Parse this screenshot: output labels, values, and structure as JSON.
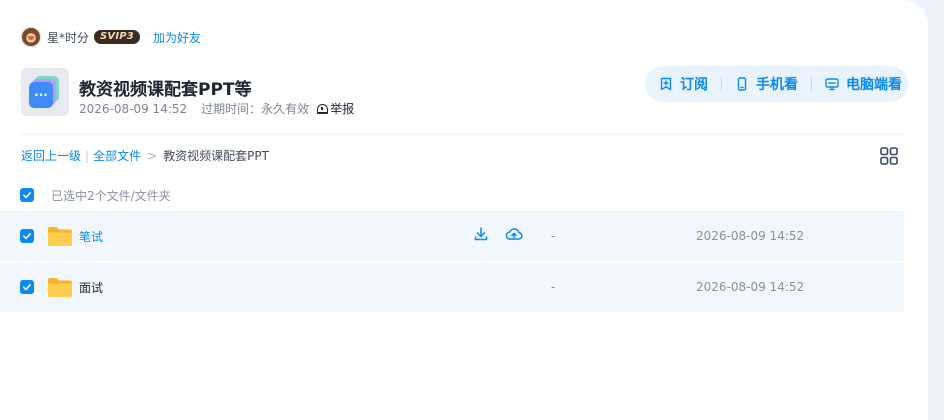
{
  "sharer": {
    "name": "星*时分",
    "badge": "SVIP3",
    "add_friend_label": "加为好友"
  },
  "share": {
    "title": "教资视频课配套PPT等",
    "date": "2026-08-09 14:52",
    "expire_label": "过期时间：永久有效",
    "report_label": "举报"
  },
  "actions": {
    "subscribe_label": "订阅",
    "mobile_label": "手机看",
    "pc_label": "电脑端看"
  },
  "breadcrumb": {
    "back_label": "返回上一级",
    "separator": "|",
    "all_files_label": "全部文件",
    "arrow": ">",
    "current_label": "教资视频课配套PPT"
  },
  "selection": {
    "summary": "已选中2个文件/文件夹"
  },
  "files": [
    {
      "name": "笔试",
      "size": "-",
      "date": "2026-08-09 14:52",
      "checked": true,
      "hovered": true
    },
    {
      "name": "面试",
      "size": "-",
      "date": "2026-08-09 14:52",
      "checked": true,
      "hovered": false
    }
  ],
  "colors": {
    "accent": "#0a8af2",
    "row_selected_bg": "#f1f7fd",
    "folder": "#ffc53d",
    "badge_bg": "#3a2b22"
  },
  "icons": {
    "subscribe": "bookmark-plus-icon",
    "mobile": "phone-icon",
    "pc": "monitor-icon",
    "report": "alarm-icon",
    "view_toggle": "grid-view-icon",
    "download": "download-icon",
    "save_cloud": "cloud-upload-icon",
    "folder": "folder-icon"
  }
}
